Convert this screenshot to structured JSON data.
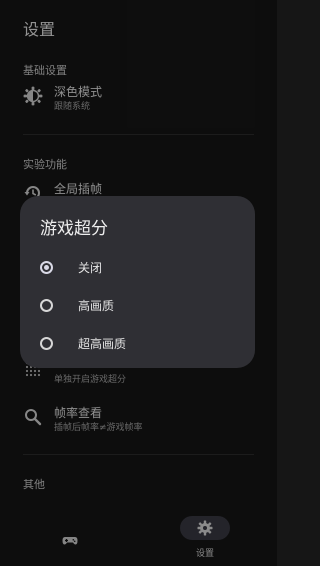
{
  "header": {
    "title": "设置"
  },
  "basic": {
    "section_title": "基础设置",
    "dark_mode": {
      "label": "深色模式",
      "sub": "跟随系统",
      "icon": "dark-mode-icon"
    }
  },
  "experimental": {
    "section_title": "实验功能",
    "global_frame": {
      "label": "全局插帧",
      "icon": "global-frame-icon"
    },
    "per_game": {
      "sub": "单独开启游戏超分",
      "icon": "grid-dots-icon"
    },
    "fps_view": {
      "label": "帧率查看",
      "sub": "插帧后帧率≠游戏帧率",
      "icon": "search-icon"
    }
  },
  "other": {
    "section_title": "其他"
  },
  "dialog": {
    "title": "游戏超分",
    "options": [
      {
        "label": "关闭",
        "checked": true
      },
      {
        "label": "高画质",
        "checked": false
      },
      {
        "label": "超高画质",
        "checked": false
      }
    ]
  },
  "navbar": {
    "games_icon": "gamepad-icon",
    "settings_label": "设置",
    "settings_icon": "gear-icon"
  },
  "colors": {
    "background": "#161616",
    "dialog": "#2f2f34",
    "nav_active_pill": "#3a3a44"
  }
}
